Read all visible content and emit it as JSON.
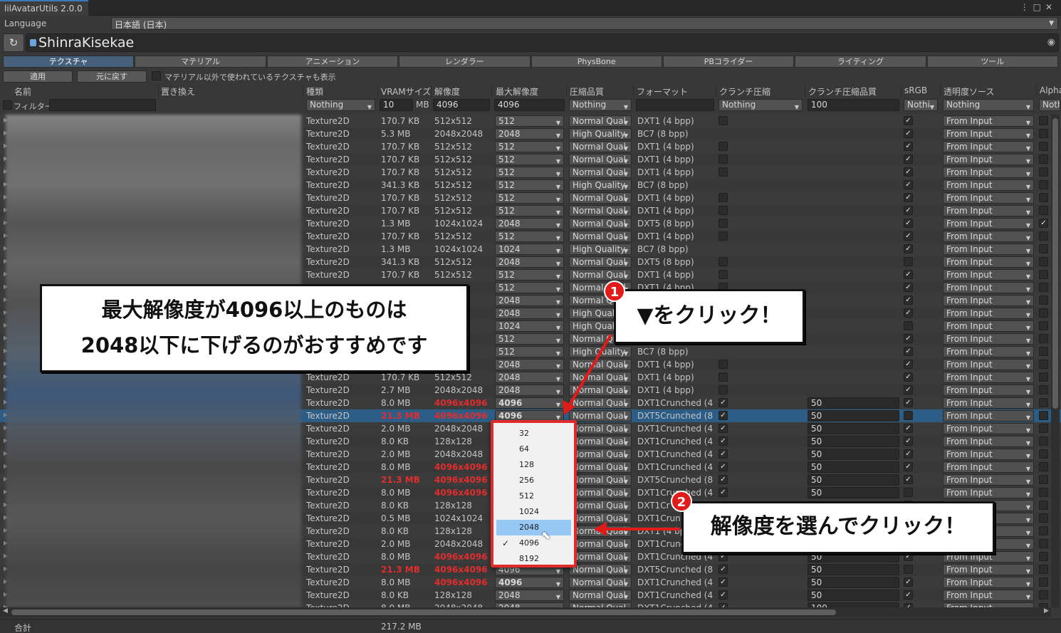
{
  "window": {
    "tab_title": "lilAvatarUtils 2.0.0",
    "icons": [
      "kebab-menu-icon",
      "maximize-icon",
      "close-icon"
    ]
  },
  "language": {
    "label": "Language",
    "value": "日本語 (日本)"
  },
  "object_field": {
    "name": "ShinraKisekae"
  },
  "tabs": [
    {
      "label": "テクスチャ",
      "active": true
    },
    {
      "label": "マテリアル"
    },
    {
      "label": "アニメーション"
    },
    {
      "label": "レンダラー"
    },
    {
      "label": "PhysBone"
    },
    {
      "label": "PBコライダー"
    },
    {
      "label": "ライティング"
    },
    {
      "label": "ツール"
    }
  ],
  "actions": {
    "apply": "適用",
    "revert": "元に戻す",
    "show_unused_label": "マテリアル以外で使われているテクスチャも表示"
  },
  "columns": {
    "name": "名前",
    "replace": "置き換え",
    "type": "種類",
    "vram": "VRAMサイズ",
    "resolution": "解像度",
    "max_resolution": "最大解像度",
    "compression": "圧縮品質",
    "format": "フォーマット",
    "crunch": "クランチ圧縮",
    "crunch_quality": "クランチ圧縮品質",
    "srgb": "sRGB",
    "alpha_source": "透明度ソース",
    "alpha": "Alpha"
  },
  "filters": {
    "filter_label": "フィルター",
    "type": "Nothing",
    "vram_value": "10",
    "vram_unit": "MB",
    "resolution": "4096",
    "max_resolution": "4096",
    "compression": "Nothing",
    "crunch": "Nothing",
    "crunch_quality": "100",
    "srgb": "Nothi",
    "alpha_source": "Nothing",
    "alpha": "Noth"
  },
  "rows": [
    {
      "type": "Texture2D",
      "vram": "170.7 KB",
      "res": "512x512",
      "max": "512",
      "comp": "Normal Qual",
      "fmt": "DXT1 (4 bpp)",
      "crunch": "off",
      "srgb": true,
      "src": "From Input"
    },
    {
      "type": "Texture2D",
      "vram": "5.3 MB",
      "res": "2048x2048",
      "max": "2048",
      "comp": "High Quality",
      "fmt": "BC7 (8 bpp)",
      "crunch": "none",
      "srgb": true,
      "src": "From Input"
    },
    {
      "type": "Texture2D",
      "vram": "170.7 KB",
      "res": "512x512",
      "max": "512",
      "comp": "Normal Qual",
      "fmt": "DXT1 (4 bpp)",
      "crunch": "off",
      "srgb": true,
      "src": "From Input"
    },
    {
      "type": "Texture2D",
      "vram": "170.7 KB",
      "res": "512x512",
      "max": "512",
      "comp": "Normal Qual",
      "fmt": "DXT1 (4 bpp)",
      "crunch": "off",
      "srgb": true,
      "src": "From Input"
    },
    {
      "type": "Texture2D",
      "vram": "170.7 KB",
      "res": "512x512",
      "max": "512",
      "comp": "Normal Qual",
      "fmt": "DXT1 (4 bpp)",
      "crunch": "off",
      "srgb": true,
      "src": "From Input"
    },
    {
      "type": "Texture2D",
      "vram": "341.3 KB",
      "res": "512x512",
      "max": "512",
      "comp": "High Quality",
      "fmt": "BC7 (8 bpp)",
      "crunch": "none",
      "srgb": true,
      "src": "From Input"
    },
    {
      "type": "Texture2D",
      "vram": "170.7 KB",
      "res": "512x512",
      "max": "512",
      "comp": "Normal Qual",
      "fmt": "DXT1 (4 bpp)",
      "crunch": "off",
      "srgb": true,
      "src": "From Input"
    },
    {
      "type": "Texture2D",
      "vram": "170.7 KB",
      "res": "512x512",
      "max": "512",
      "comp": "Normal Qual",
      "fmt": "DXT1 (4 bpp)",
      "crunch": "off",
      "srgb": true,
      "src": "From Input"
    },
    {
      "type": "Texture2D",
      "vram": "1.3 MB",
      "res": "1024x1024",
      "max": "2048",
      "comp": "Normal Qual",
      "fmt": "DXT5 (8 bpp)",
      "crunch": "off",
      "srgb": true,
      "src": "From Input",
      "alpha": true
    },
    {
      "type": "Texture2D",
      "vram": "170.7 KB",
      "res": "512x512",
      "max": "512",
      "comp": "Normal Qual",
      "fmt": "DXT1 (4 bpp)",
      "crunch": "off",
      "srgb": true,
      "src": "From Input"
    },
    {
      "type": "Texture2D",
      "vram": "1.3 MB",
      "res": "1024x1024",
      "max": "1024",
      "comp": "High Quality",
      "fmt": "BC7 (8 bpp)",
      "crunch": "none",
      "srgb": true,
      "src": "From Input"
    },
    {
      "type": "Texture2D",
      "vram": "341.3 KB",
      "res": "512x512",
      "max": "2048",
      "comp": "Normal Qual",
      "fmt": "DXT5 (8 bpp)",
      "crunch": "off",
      "srgb": false,
      "src": "From Input"
    },
    {
      "type": "Texture2D",
      "vram": "170.7 KB",
      "res": "512x512",
      "max": "512",
      "comp": "Normal Qual",
      "fmt": "DXT1 (4 bpp)",
      "crunch": "off",
      "srgb": true,
      "src": "From Input"
    },
    {
      "type": "",
      "vram": "",
      "res": "",
      "max": "512",
      "comp": "Normal Qual",
      "fmt": "DXT1 (4 bpp)",
      "crunch": "off",
      "srgb": true,
      "src": "From Input"
    },
    {
      "type": "",
      "vram": "",
      "res": "24",
      "max": "2048",
      "comp": "Normal Qual",
      "fmt": "",
      "crunch": "off",
      "srgb": true,
      "src": "From Input"
    },
    {
      "type": "",
      "vram": "",
      "res": "48",
      "max": "2048",
      "comp": "High Quali",
      "fmt": "",
      "crunch": "none",
      "srgb": true,
      "src": "From Input"
    },
    {
      "type": "",
      "vram": "",
      "res": "24",
      "max": "1024",
      "comp": "High Quali",
      "fmt": "",
      "crunch": "none",
      "srgb": false,
      "src": "From Input"
    },
    {
      "type": "",
      "vram": "",
      "res": "",
      "max": "512",
      "comp": "Normal Qu",
      "fmt": "",
      "crunch": "off",
      "srgb": true,
      "src": "From Input"
    },
    {
      "type": "",
      "vram": "",
      "res": "",
      "max": "512",
      "comp": "High Quality",
      "fmt": "BC7 (8 bpp)",
      "crunch": "none",
      "srgb": true,
      "src": "From Input"
    },
    {
      "type": "",
      "vram": "",
      "res": "24",
      "max": "2048",
      "comp": "Normal Qual",
      "fmt": "DXT1 (4 bpp)",
      "crunch": "off",
      "srgb": true,
      "src": "From Input"
    },
    {
      "type": "Texture2D",
      "vram": "170.7 KB",
      "res": "512x512",
      "max": "2048",
      "comp": "Normal Qual",
      "fmt": "DXT1 (4 bpp)",
      "crunch": "off",
      "srgb": true,
      "src": "From Input"
    },
    {
      "type": "Texture2D",
      "vram": "2.7 MB",
      "res": "2048x2048",
      "max": "2048",
      "comp": "Normal Qual",
      "fmt": "DXT1 (4 bpp)",
      "crunch": "off",
      "srgb": true,
      "src": "From Input"
    },
    {
      "type": "Texture2D",
      "vram": "8.0 MB",
      "res": "4096x4096",
      "max": "4096",
      "comp": "Normal Qual",
      "fmt": "DXT1Crunched (4 b",
      "crunch": "on",
      "cq": "50",
      "srgb": true,
      "src": "From Input",
      "hres": true,
      "hmax": true
    },
    {
      "type": "Texture2D",
      "vram": "21.3 MB",
      "res": "4096x4096",
      "max": "4096",
      "comp": "Normal Qual",
      "fmt": "DXT5Crunched (8 b",
      "crunch": "on",
      "cq": "50",
      "srgb": false,
      "src": "From Input",
      "hvram": true,
      "hres": true,
      "hmax": true,
      "sel": true
    },
    {
      "type": "Texture2D",
      "vram": "2.0 MB",
      "res": "2048x2048",
      "max": "2048",
      "comp": "Normal Qual",
      "fmt": "DXT1Crunched (4 b",
      "crunch": "on",
      "cq": "50",
      "srgb": true,
      "src": "From Input"
    },
    {
      "type": "Texture2D",
      "vram": "8.0 KB",
      "res": "128x128",
      "max": "128",
      "comp": "Normal Qual",
      "fmt": "DXT1Crunched (4 b",
      "crunch": "on",
      "cq": "50",
      "srgb": true,
      "src": "From Input"
    },
    {
      "type": "Texture2D",
      "vram": "2.0 MB",
      "res": "2048x2048",
      "max": "2048",
      "comp": "Normal Qual",
      "fmt": "DXT1Crunched (4 b",
      "crunch": "on",
      "cq": "50",
      "srgb": true,
      "src": "From Input"
    },
    {
      "type": "Texture2D",
      "vram": "8.0 MB",
      "res": "4096x4096",
      "max": "4096",
      "comp": "Normal Qual",
      "fmt": "DXT1Crunched (4 b",
      "crunch": "on",
      "cq": "50",
      "srgb": true,
      "src": "From Input",
      "hres": true
    },
    {
      "type": "Texture2D",
      "vram": "21.3 MB",
      "res": "4096x4096",
      "max": "4096",
      "comp": "Normal Qual",
      "fmt": "DXT5Crunched (8 b",
      "crunch": "on",
      "cq": "50",
      "srgb": true,
      "src": "From Input",
      "hvram": true,
      "hres": true
    },
    {
      "type": "Texture2D",
      "vram": "8.0 MB",
      "res": "4096x4096",
      "max": "4096",
      "comp": "Normal Qual",
      "fmt": "DXT1Crunched (4 b",
      "crunch": "on",
      "cq": "50",
      "srgb": false,
      "src": "From Input",
      "hres": true
    },
    {
      "type": "Texture2D",
      "vram": "8.0 KB",
      "res": "128x128",
      "max": "128",
      "comp": "Normal Qual",
      "fmt": "DXT1Cr",
      "crunch": "",
      "srgb": true,
      "src": "From Input"
    },
    {
      "type": "Texture2D",
      "vram": "0.5 MB",
      "res": "1024x1024",
      "max": "1024",
      "comp": "Normal Qual",
      "fmt": "DXT1Crun",
      "crunch": "",
      "srgb": true,
      "src": "From Input"
    },
    {
      "type": "Texture2D",
      "vram": "8.0 KB",
      "res": "128x128",
      "max": "128",
      "comp": "Normal Qual",
      "fmt": "DXT1 (4 bp",
      "crunch": "",
      "srgb": true,
      "src": "From Input"
    },
    {
      "type": "Texture2D",
      "vram": "2.0 MB",
      "res": "2048x2048",
      "max": "2048",
      "comp": "Normal Qual",
      "fmt": "DXT1Crunched (4 b",
      "crunch": "",
      "srgb": true,
      "src": "From Input"
    },
    {
      "type": "Texture2D",
      "vram": "8.0 MB",
      "res": "4096x4096",
      "max": "4096",
      "comp": "Normal Qual",
      "fmt": "DXT1Crunched (4 b",
      "crunch": "on",
      "cq": "50",
      "srgb": true,
      "src": "From Input",
      "hres": true
    },
    {
      "type": "Texture2D",
      "vram": "21.3 MB",
      "res": "4096x4096",
      "max": "4096",
      "comp": "Normal Qual",
      "fmt": "DXT5Crunched (8 b",
      "crunch": "on",
      "cq": "50",
      "srgb": false,
      "src": "From Input",
      "hvram": true,
      "hres": true
    },
    {
      "type": "Texture2D",
      "vram": "8.0 MB",
      "res": "4096x4096",
      "max": "4096",
      "comp": "Normal Qual",
      "fmt": "DXT1Crunched (4 b",
      "crunch": "on",
      "cq": "50",
      "srgb": true,
      "src": "From Input",
      "hres": true,
      "hmax": true
    },
    {
      "type": "Texture2D",
      "vram": "8.0 KB",
      "res": "128x128",
      "max": "2048",
      "comp": "Normal Qual",
      "fmt": "DXT1Crunched (4 b",
      "crunch": "on",
      "cq": "50",
      "srgb": true,
      "src": "From Input"
    },
    {
      "type": "Texture2D",
      "vram": "8.0 MB",
      "res": "2048x2048",
      "max": "2048",
      "comp": "Normal Qual",
      "fmt": "DXT1Crunched (4 b",
      "crunch": "on",
      "cq": "100",
      "srgb": true,
      "src": "From Input"
    }
  ],
  "dropdown": {
    "options": [
      "32",
      "64",
      "128",
      "256",
      "512",
      "1024",
      "2048",
      "4096",
      "8192"
    ],
    "highlighted": "2048",
    "checked": "4096"
  },
  "annotations": {
    "note": [
      "最大解像度が4096以上のものは",
      "2048以下に下げるのがおすすめです"
    ],
    "step1_number": "1",
    "step1_text": "▼をクリック！",
    "step2_number": "2",
    "step2_text": "解像度を選んでクリック！",
    "accent_color": "#e11a1a"
  },
  "status": {
    "label": "合計",
    "total": "217.2 MB"
  }
}
